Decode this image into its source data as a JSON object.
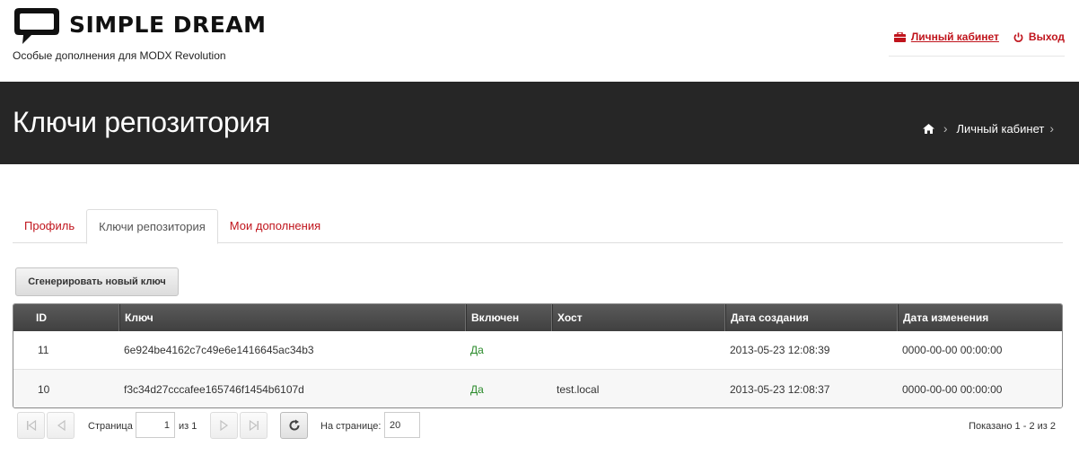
{
  "brand": {
    "name": "SIMPLE DREAM",
    "tagline": "Особые дополнения для MODX Revolution"
  },
  "user_menu": {
    "cabinet": "Личный кабинет",
    "logout": "Выход"
  },
  "banner": {
    "title": "Ключи репозитория",
    "breadcrumb": [
      "Личный кабинет"
    ]
  },
  "tabs": [
    {
      "label": "Профиль",
      "active": false
    },
    {
      "label": "Ключи репозитория",
      "active": true
    },
    {
      "label": "Мои дополнения",
      "active": false
    }
  ],
  "generate_button": "Сгенерировать новый ключ",
  "grid": {
    "columns": [
      "ID",
      "Ключ",
      "Включен",
      "Хост",
      "Дата создания",
      "Дата изменения"
    ],
    "rows": [
      {
        "id": "11",
        "key": "6e924be4162c7c49e6e1416645ac34b3",
        "enabled": "Да",
        "host": "",
        "created": "2013-05-23 12:08:39",
        "updated": "0000-00-00 00:00:00"
      },
      {
        "id": "10",
        "key": "f3c34d27cccafee165746f1454b6107d",
        "enabled": "Да",
        "host": "test.local",
        "created": "2013-05-23 12:08:37",
        "updated": "0000-00-00 00:00:00"
      }
    ]
  },
  "paging": {
    "page_label": "Страница",
    "page_value": "1",
    "of_label": "из 1",
    "per_page_label": "На странице:",
    "per_page_value": "20",
    "summary": "Показано 1 - 2 из 2"
  },
  "colors": {
    "accent": "#c0141c",
    "banner": "#262626",
    "enabled": "#2a8a2a"
  }
}
